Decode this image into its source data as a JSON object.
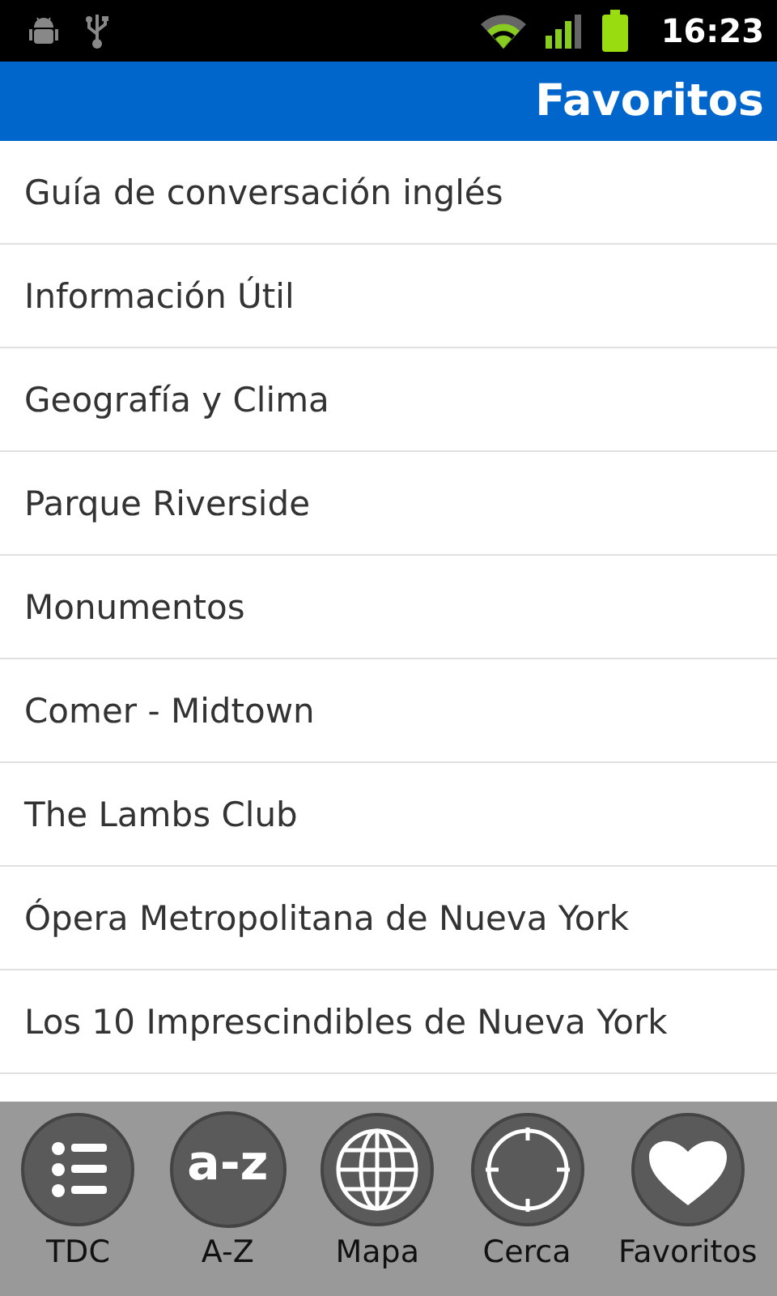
{
  "status_bar": {
    "time": "16:23"
  },
  "header": {
    "title": "Favoritos"
  },
  "list": {
    "items": [
      {
        "label": "Guía de conversación inglés"
      },
      {
        "label": "Información Útil"
      },
      {
        "label": "Geografía y Clima"
      },
      {
        "label": "Parque Riverside"
      },
      {
        "label": "Monumentos"
      },
      {
        "label": "Comer - Midtown"
      },
      {
        "label": "The Lambs Club"
      },
      {
        "label": "Ópera Metropolitana de Nueva York"
      },
      {
        "label": "Los 10 Imprescindibles de Nueva York"
      }
    ]
  },
  "bottom_nav": [
    {
      "kind": "list",
      "label": "TDC"
    },
    {
      "kind": "text",
      "icon_text": "a-z",
      "label": "A-Z"
    },
    {
      "kind": "globe",
      "label": "Mapa"
    },
    {
      "kind": "target",
      "label": "Cerca"
    },
    {
      "kind": "heart",
      "label": "Favoritos"
    }
  ]
}
